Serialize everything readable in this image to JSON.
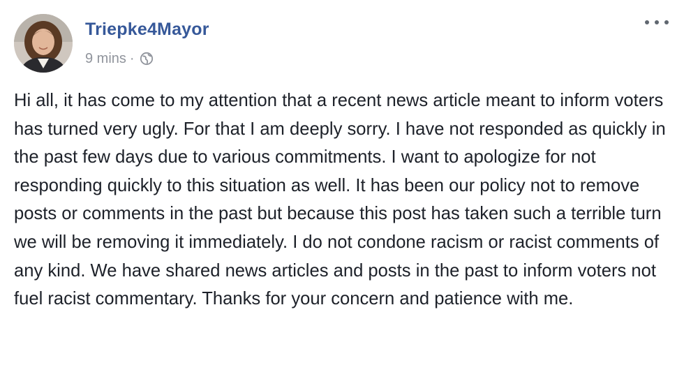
{
  "post": {
    "author": "Triepke4Mayor",
    "timestamp": "9 mins",
    "separator": "·",
    "privacy_icon": "globe-icon",
    "more_icon": "more-options-icon",
    "avatar_icon": "profile-photo",
    "message": "Hi all, it has come to my attention that a recent news article meant to inform voters has turned very ugly. For that I am deeply sorry. I have not responded as quickly in the past few days due to various commitments. I want to apologize for not responding quickly to this situation as well. It has been our policy not to remove posts or comments in the past but because this post has taken such a terrible turn we will be removing it immediately. I do not condone racism or racist comments of any kind. We have shared news articles and posts in the past to inform voters not fuel racist commentary. Thanks for your concern and patience with me."
  },
  "colors": {
    "author_link": "#365899",
    "meta_text": "#90949c",
    "body_text": "#1d2129",
    "background": "#ffffff"
  }
}
